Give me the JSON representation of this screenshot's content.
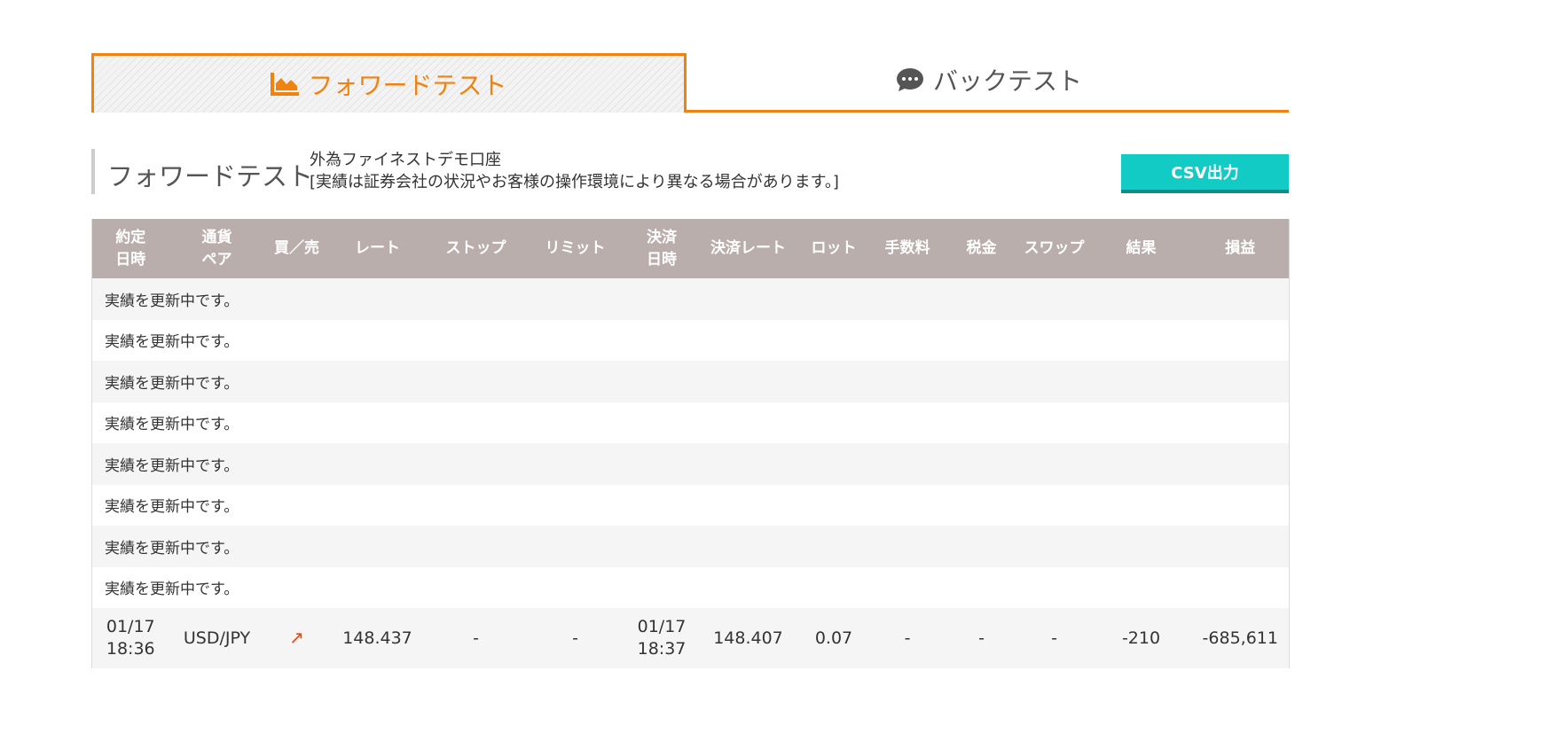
{
  "tabs": {
    "forward_label": "フォワードテスト",
    "back_label": "バックテスト",
    "forward_icon": "area-chart-icon",
    "back_icon": "chat-bubble-icon"
  },
  "header": {
    "title": "フォワードテスト",
    "account": "外為ファイネストデモ口座",
    "disclaimer": "[実績は証券会社の状況やお客様の操作環境により異なる場合があります。]",
    "csv_button": "CSV出力"
  },
  "table": {
    "columns": [
      "約定\n日時",
      "通貨\nペア",
      "買／売",
      "レート",
      "ストップ",
      "リミット",
      "決済\n日時",
      "決済レート",
      "ロット",
      "手数料",
      "税金",
      "スワップ",
      "結果",
      "損益"
    ],
    "note_rows": [
      "実績を更新中です。",
      "実績を更新中です。",
      "実績を更新中です。",
      "実績を更新中です。",
      "実績を更新中です。",
      "実績を更新中です。",
      "実績を更新中です。",
      "実績を更新中です。"
    ],
    "trade": {
      "open_time": "01/17\n18:36",
      "pair": "USD/JPY",
      "side_icon": "buy-arrow-up-right-icon",
      "side_glyph": "↗",
      "rate": "148.437",
      "stop": "-",
      "limit": "-",
      "close_time": "01/17\n18:37",
      "close_rate": "148.407",
      "lot": "0.07",
      "fee": "-",
      "tax": "-",
      "swap": "-",
      "result": "-210",
      "pnl": "-685,611"
    }
  },
  "colors": {
    "accent_orange": "#f0820f",
    "csv_teal": "#12cbc4",
    "header_row": "#baaeac",
    "buy_arrow": "#f0440f"
  }
}
